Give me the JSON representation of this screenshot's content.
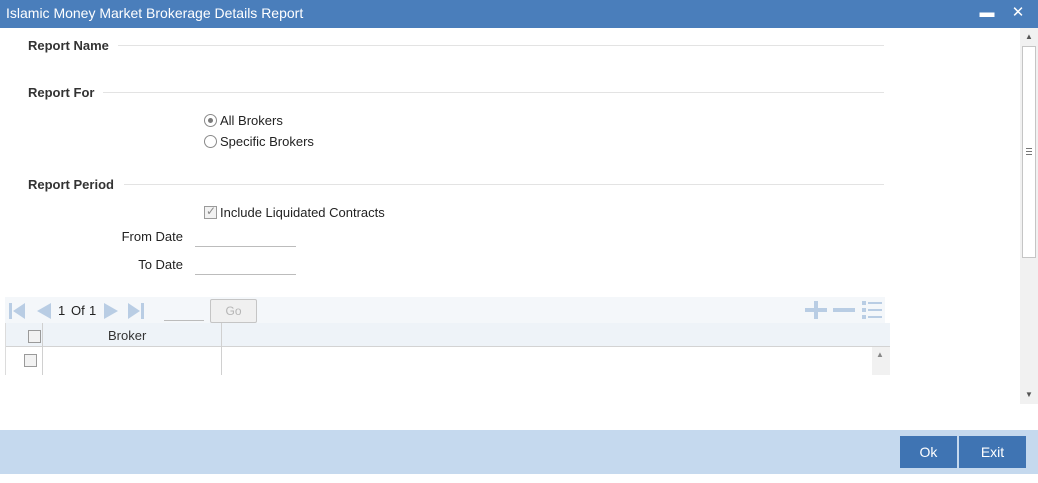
{
  "window": {
    "title": "Islamic Money Market Brokerage Details Report",
    "minimize_symbol": "▬",
    "close_symbol": "✕"
  },
  "sections": {
    "report_name": "Report Name",
    "report_for": "Report For",
    "report_period": "Report Period"
  },
  "report_for": {
    "options": [
      "All Brokers",
      "Specific Brokers"
    ],
    "selected": "All Brokers"
  },
  "report_period": {
    "include_liquidated_label": "Include Liquidated Contracts",
    "include_liquidated_checked": true,
    "from_date_label": "From Date",
    "from_date_value": "",
    "to_date_label": "To Date",
    "to_date_value": ""
  },
  "pager": {
    "current": "1",
    "of_label": "Of",
    "total": "1",
    "go_label": "Go",
    "page_input_value": ""
  },
  "grid": {
    "columns": [
      "Broker"
    ],
    "rows": [
      {
        "broker": ""
      }
    ]
  },
  "footer": {
    "ok_label": "Ok",
    "exit_label": "Exit"
  },
  "colors": {
    "titlebar": "#4a7ebb",
    "footer": "#c5d9ee",
    "button": "#3f74b3"
  }
}
